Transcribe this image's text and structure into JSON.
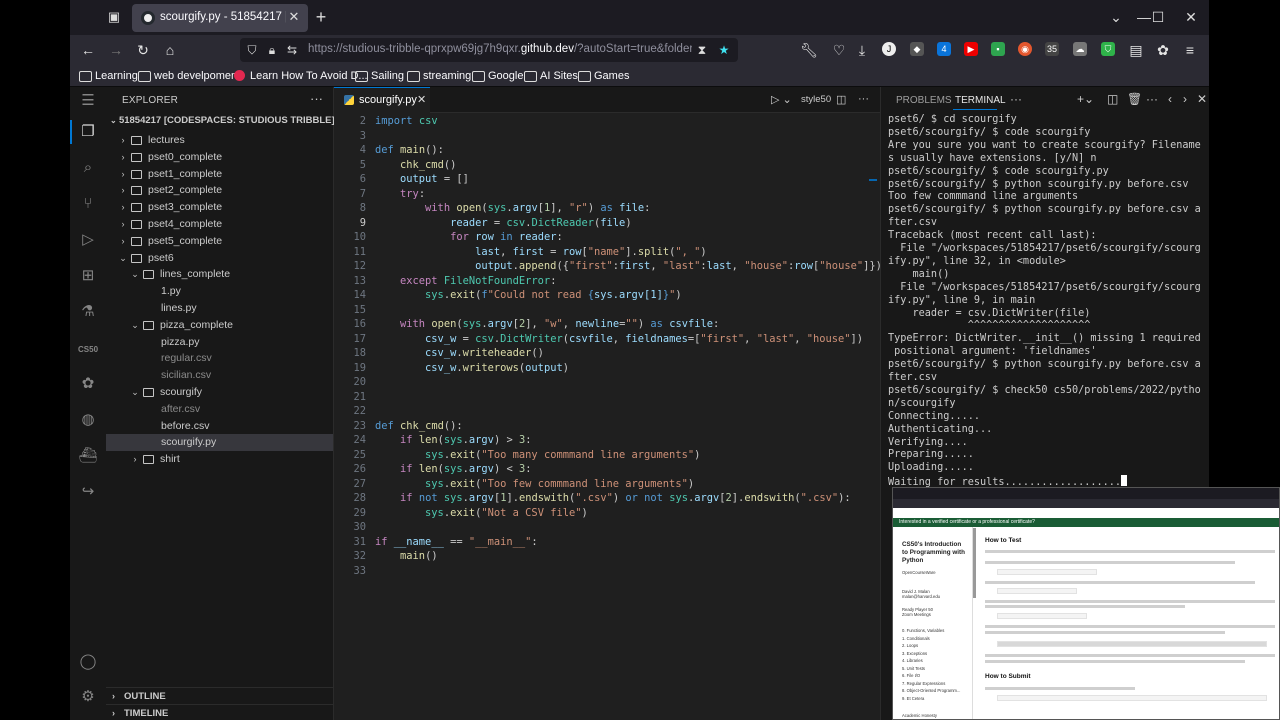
{
  "browser": {
    "tab_title": "scourgify.py - 51854217 [Codes",
    "url_prefix": "https://studious-tribble-qprxpw69jg7h9qxr.",
    "url_domain": "github.dev",
    "url_suffix": "/?autoStart=true&folder=%",
    "bookmarks": [
      "Learning",
      "web develpoment",
      "Learn How To Avoid D...",
      "Sailing",
      "streaming",
      "Google",
      "AI Sites",
      "Games"
    ],
    "ext_badges": [
      "4",
      "35"
    ]
  },
  "explorer": {
    "title": "EXPLORER",
    "workspace": "51854217 [CODESPACES: STUDIOUS TRIBBLE]",
    "tree": [
      {
        "label": "lectures",
        "type": "folder",
        "open": false,
        "depth": 1
      },
      {
        "label": "pset0_complete",
        "type": "folder",
        "open": false,
        "depth": 1
      },
      {
        "label": "pset1_complete",
        "type": "folder",
        "open": false,
        "depth": 1
      },
      {
        "label": "pset2_complete",
        "type": "folder",
        "open": false,
        "depth": 1
      },
      {
        "label": "pset3_complete",
        "type": "folder",
        "open": false,
        "depth": 1
      },
      {
        "label": "pset4_complete",
        "type": "folder",
        "open": false,
        "depth": 1
      },
      {
        "label": "pset5_complete",
        "type": "folder",
        "open": false,
        "depth": 1
      },
      {
        "label": "pset6",
        "type": "folder",
        "open": true,
        "depth": 1
      },
      {
        "label": "lines_complete",
        "type": "folder",
        "open": true,
        "depth": 2
      },
      {
        "label": "1.py",
        "type": "file",
        "depth": 3
      },
      {
        "label": "lines.py",
        "type": "file",
        "depth": 3
      },
      {
        "label": "pizza_complete",
        "type": "folder",
        "open": true,
        "depth": 2
      },
      {
        "label": "pizza.py",
        "type": "file",
        "depth": 3
      },
      {
        "label": "regular.csv",
        "type": "file",
        "depth": 3,
        "dim": true
      },
      {
        "label": "sicilian.csv",
        "type": "file",
        "depth": 3,
        "dim": true
      },
      {
        "label": "scourgify",
        "type": "folder",
        "open": true,
        "depth": 2
      },
      {
        "label": "after.csv",
        "type": "file",
        "depth": 3,
        "dim": true
      },
      {
        "label": "before.csv",
        "type": "file",
        "depth": 3
      },
      {
        "label": "scourgify.py",
        "type": "file",
        "depth": 3,
        "selected": true
      },
      {
        "label": "shirt",
        "type": "folder",
        "open": false,
        "depth": 2
      }
    ],
    "outline": "OUTLINE",
    "timeline": "TIMELINE"
  },
  "editor": {
    "tab_name": "scourgify.py",
    "style_label": "style50",
    "current_line": 9,
    "lines": [
      {
        "n": 2,
        "code": "import csv"
      },
      {
        "n": 3,
        "code": ""
      },
      {
        "n": 4,
        "code": "def main():"
      },
      {
        "n": 5,
        "code": "    chk_cmd()"
      },
      {
        "n": 6,
        "code": "    output = []"
      },
      {
        "n": 7,
        "code": "    try:"
      },
      {
        "n": 8,
        "code": "        with open(sys.argv[1], \"r\") as file:"
      },
      {
        "n": 9,
        "code": "            reader = csv.DictReader(file)"
      },
      {
        "n": 10,
        "code": "            for row in reader:"
      },
      {
        "n": 11,
        "code": "                last, first = row[\"name\"].split(\", \")"
      },
      {
        "n": 12,
        "code": "                output.append({\"first\":first, \"last\":last, \"house\":row[\"house\"]})"
      },
      {
        "n": 13,
        "code": "    except FileNotFoundError:"
      },
      {
        "n": 14,
        "code": "        sys.exit(f\"Could not read {sys.argv[1]}\")"
      },
      {
        "n": 15,
        "code": ""
      },
      {
        "n": 16,
        "code": "    with open(sys.argv[2], \"w\", newline=\"\") as csvfile:"
      },
      {
        "n": 17,
        "code": "        csv_w = csv.DictWriter(csvfile, fieldnames=[\"first\", \"last\", \"house\"])"
      },
      {
        "n": 18,
        "code": "        csv_w.writeheader()"
      },
      {
        "n": 19,
        "code": "        csv_w.writerows(output)"
      },
      {
        "n": 20,
        "code": ""
      },
      {
        "n": 21,
        "code": ""
      },
      {
        "n": 22,
        "code": ""
      },
      {
        "n": 23,
        "code": "def chk_cmd():"
      },
      {
        "n": 24,
        "code": "    if len(sys.argv) > 3:"
      },
      {
        "n": 25,
        "code": "        sys.exit(\"Too many commmand line arguments\")"
      },
      {
        "n": 26,
        "code": "    if len(sys.argv) < 3:"
      },
      {
        "n": 27,
        "code": "        sys.exit(\"Too few commmand line arguments\")"
      },
      {
        "n": 28,
        "code": "    if not sys.argv[1].endswith(\".csv\") or not sys.argv[2].endswith(\".csv\"):"
      },
      {
        "n": 29,
        "code": "        sys.exit(\"Not a CSV file\")"
      },
      {
        "n": 30,
        "code": ""
      },
      {
        "n": 31,
        "code": "if __name__ == \"__main__\":"
      },
      {
        "n": 32,
        "code": "    main()"
      },
      {
        "n": 33,
        "code": ""
      }
    ]
  },
  "panel": {
    "tabs": [
      "PROBLEMS",
      "TERMINAL"
    ],
    "active_tab": "TERMINAL",
    "terminal_lines": [
      "pset6/ $ cd scourgify",
      "pset6/scourgify/ $ code scourgify",
      "Are you sure you want to create scourgify? Filename",
      "s usually have extensions. [y/N] n",
      "pset6/scourgify/ $ code scourgify.py",
      "pset6/scourgify/ $ python scourgify.py before.csv",
      "Too few commmand line arguments",
      "pset6/scourgify/ $ python scourgify.py before.csv a",
      "fter.csv",
      "Traceback (most recent call last):",
      "  File \"/workspaces/51854217/pset6/scourgify/scourg",
      "ify.py\", line 32, in <module>",
      "    main()",
      "  File \"/workspaces/51854217/pset6/scourgify/scourg",
      "ify.py\", line 9, in main",
      "    reader = csv.DictWriter(file)",
      "             ^^^^^^^^^^^^^^^^^^^^",
      "TypeError: DictWriter.__init__() missing 1 required",
      " positional argument: 'fieldnames'",
      "pset6/scourgify/ $ python scourgify.py before.csv a",
      "fter.csv",
      "pset6/scourgify/ $ check50 cs50/problems/2022/pytho",
      "n/scourgify",
      "Connecting.....",
      "Authenticating...",
      "Verifying....",
      "Preparing.....",
      "Uploading.....",
      "Waiting for results..................."
    ]
  },
  "overlay": {
    "banner": "Interested in a verified certificate or a professional certificate?",
    "course_title": "CS50's Introduction to Programming with Python",
    "course_sub": "OpenCourseWare",
    "author": "David J. Malan",
    "email": "malan@harvard.edu",
    "ready_player": "Ready Player 50",
    "zoom": "Zoom Meetings",
    "nav": [
      "0. Functions, Variables",
      "1. Conditionals",
      "2. Loops",
      "3. Exceptions",
      "4. Libraries",
      "5. Unit Tests",
      "6. File I/O",
      "7. Regular Expressions",
      "8. Object-Oriented Programm...",
      "9. Et Cetera"
    ],
    "academic": "Academic Honesty",
    "h_test": "How to Test",
    "h_submit": "How to Submit"
  }
}
